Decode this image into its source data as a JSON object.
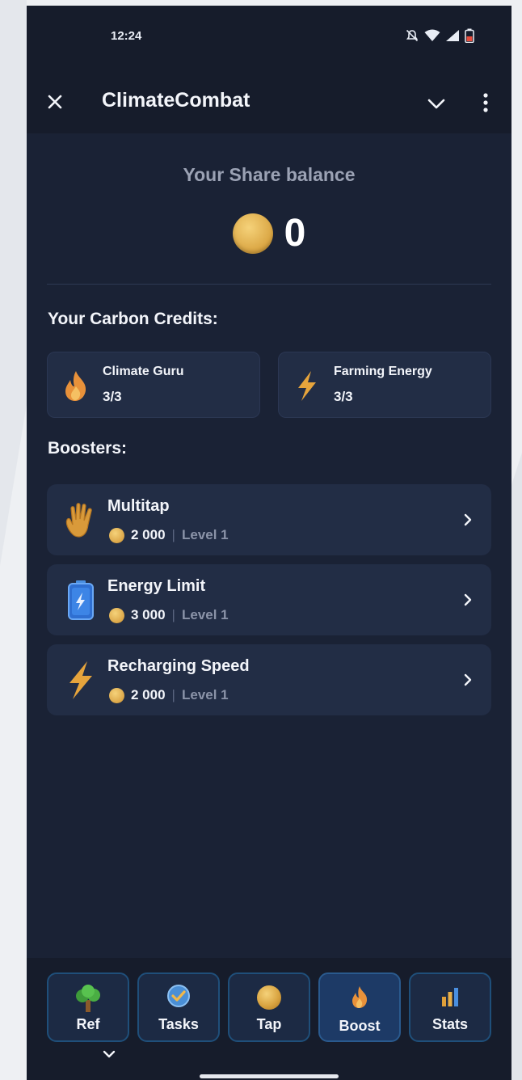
{
  "status_bar": {
    "time": "12:24"
  },
  "app_bar": {
    "title": "ClimateCombat"
  },
  "balance": {
    "label": "Your Share balance",
    "value": "0"
  },
  "carbon_credits": {
    "title": "Your Carbon Credits:",
    "items": [
      {
        "name": "Climate Guru",
        "count": "3/3",
        "icon": "flame-icon"
      },
      {
        "name": "Farming Energy",
        "count": "3/3",
        "icon": "lightning-icon"
      }
    ]
  },
  "boosters": {
    "title": "Boosters:",
    "items": [
      {
        "name": "Multitap",
        "price": "2 000",
        "level": "Level 1",
        "icon": "hand-icon"
      },
      {
        "name": "Energy Limit",
        "price": "3 000",
        "level": "Level 1",
        "icon": "battery-icon"
      },
      {
        "name": "Recharging Speed",
        "price": "2 000",
        "level": "Level 1",
        "icon": "lightning-icon"
      }
    ]
  },
  "nav": {
    "items": [
      {
        "label": "Ref",
        "icon": "tree-icon"
      },
      {
        "label": "Tasks",
        "icon": "check-badge-icon"
      },
      {
        "label": "Tap",
        "icon": "coin-icon"
      },
      {
        "label": "Boost",
        "icon": "flame-icon",
        "active": true
      },
      {
        "label": "Stats",
        "icon": "bar-chart-icon"
      }
    ]
  },
  "colors": {
    "background": "#161c2b",
    "content": "#1a2235",
    "card": "#222d45",
    "coin": "#d9a441",
    "nav_border": "#1f4f7a",
    "nav_active": "#1d3a66"
  }
}
